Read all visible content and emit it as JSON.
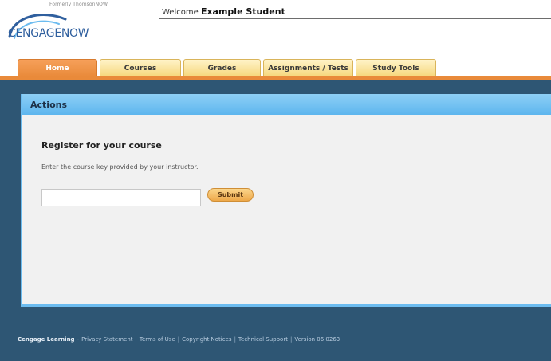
{
  "header": {
    "formerly": "Formerly ThomsonNOW",
    "logo_text": "CENGAGENOW",
    "welcome_prefix": "Welcome",
    "student_name": "Example Student"
  },
  "tabs": [
    {
      "label": "Home",
      "active": true
    },
    {
      "label": "Courses",
      "active": false
    },
    {
      "label": "Grades",
      "active": false
    },
    {
      "label": "Assignments / Tests",
      "active": false
    },
    {
      "label": "Study Tools",
      "active": false
    }
  ],
  "panel": {
    "title": "Actions",
    "register_title": "Register for your course",
    "register_desc": "Enter the course key provided by your instructor.",
    "course_key_value": "",
    "submit_label": "Submit"
  },
  "footer": {
    "brand": "Cengage Learning",
    "links": [
      "Privacy Statement",
      "Terms of Use",
      "Copyright Notices",
      "Technical Support"
    ],
    "version": "Version 06.0263"
  },
  "colors": {
    "accent_orange": "#e98a3a",
    "panel_blue": "#5db6ee",
    "background_navy": "#2e5674",
    "logo_blue": "#2f5f9e"
  }
}
